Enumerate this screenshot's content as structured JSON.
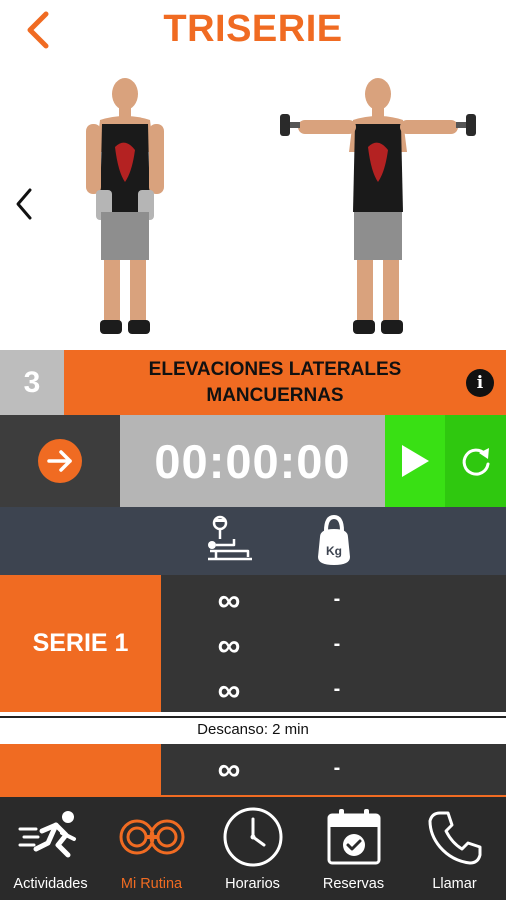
{
  "header": {
    "title": "TRISERIE"
  },
  "exercise": {
    "number": "3",
    "name": "ELEVACIONES LATERALES MANCUERNAS",
    "info_label": "i"
  },
  "timer": {
    "value": "00:00:00"
  },
  "series": [
    {
      "label": "SERIE 1",
      "sets": [
        {
          "reps": "∞",
          "weight": "-"
        },
        {
          "reps": "∞",
          "weight": "-"
        },
        {
          "reps": "∞",
          "weight": "-"
        }
      ]
    },
    {
      "label": "",
      "sets": [
        {
          "reps": "∞",
          "weight": "-"
        }
      ]
    }
  ],
  "rest": {
    "text": "Descanso: 2 min"
  },
  "nav": {
    "items": [
      {
        "label": "Actividades",
        "icon": "running-icon"
      },
      {
        "label": "Mi Rutina",
        "icon": "dumbbell-icon",
        "active": true
      },
      {
        "label": "Horarios",
        "icon": "clock-icon"
      },
      {
        "label": "Reservas",
        "icon": "calendar-check-icon"
      },
      {
        "label": "Llamar",
        "icon": "phone-icon"
      }
    ]
  },
  "colors": {
    "accent": "#f06b22",
    "play_green": "#39e014",
    "reset_green": "#2fc80f",
    "dark": "#353535"
  }
}
